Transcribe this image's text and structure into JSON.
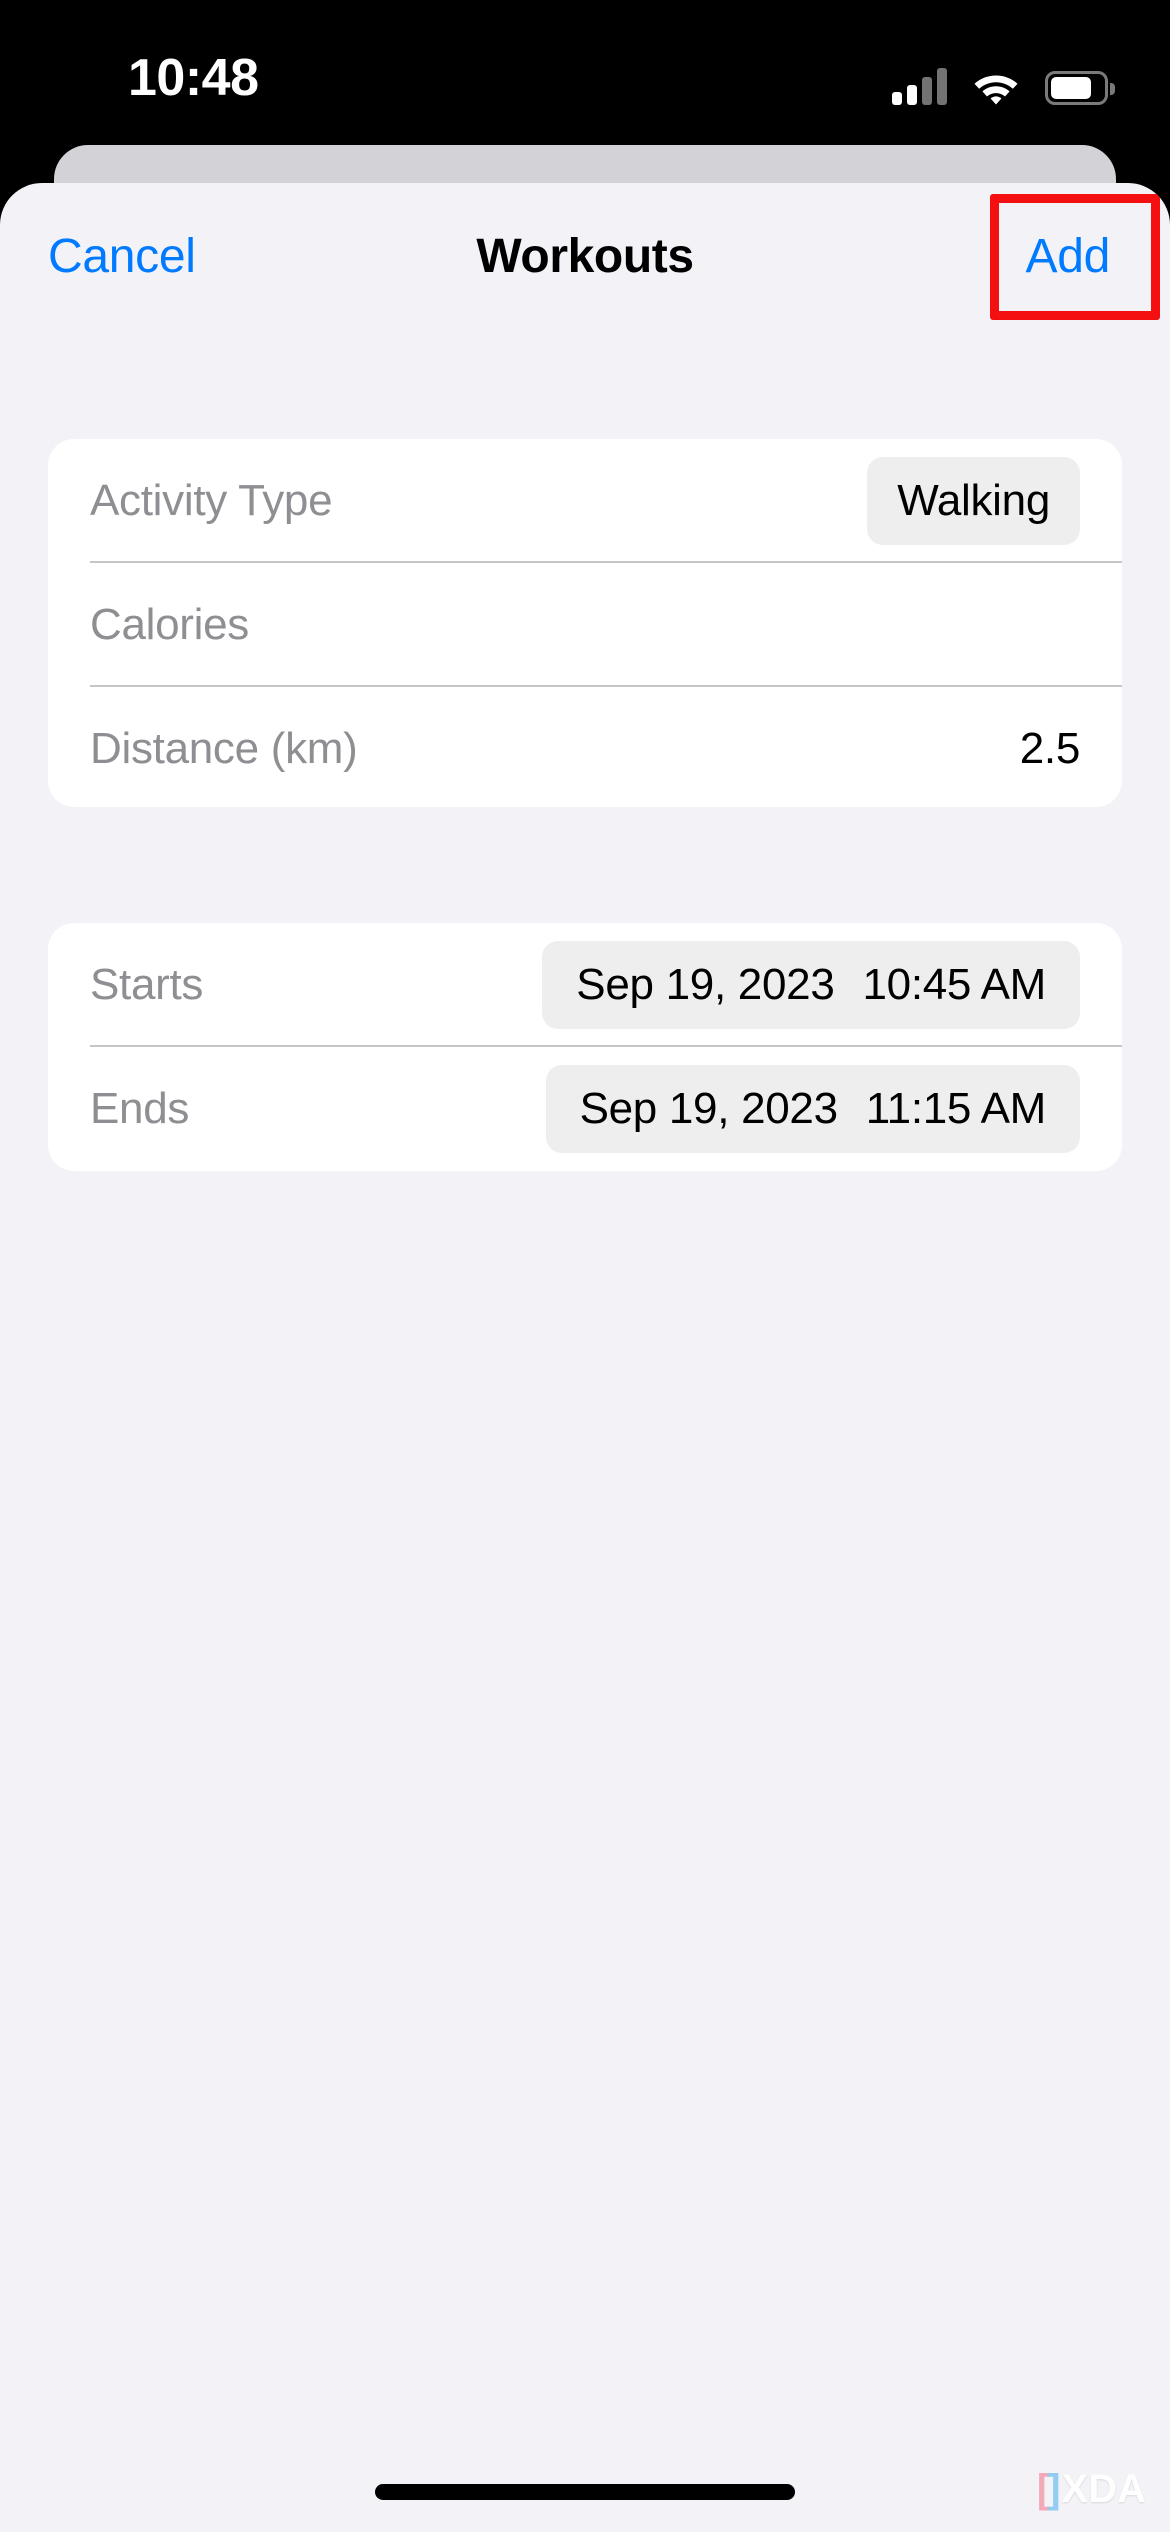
{
  "status_bar": {
    "time": "10:48",
    "signal_icon": "cellular-signal-icon",
    "signal_bars_total": 4,
    "signal_bars_active": 2,
    "wifi_icon": "wifi-icon",
    "battery_icon": "battery-icon",
    "battery_level_percent": 62
  },
  "nav_bar": {
    "cancel_label": "Cancel",
    "title": "Workouts",
    "add_label": "Add",
    "highlight_color": "#f40f10",
    "accent_color": "#007aff"
  },
  "activity_card": {
    "rows": [
      {
        "label": "Activity Type",
        "value": "Walking",
        "value_style": "pill"
      },
      {
        "label": "Calories",
        "value": "",
        "value_style": "plain"
      },
      {
        "label": "Distance (km)",
        "value": "2.5",
        "value_style": "plain"
      }
    ]
  },
  "schedule_card": {
    "rows": [
      {
        "label": "Starts",
        "date": "Sep 19, 2023",
        "time": "10:45 AM"
      },
      {
        "label": "Ends",
        "date": "Sep 19, 2023",
        "time": "11:15 AM"
      }
    ]
  },
  "watermark": {
    "bracket_left": "[",
    "bracket_right": "]",
    "text": "XDA"
  }
}
